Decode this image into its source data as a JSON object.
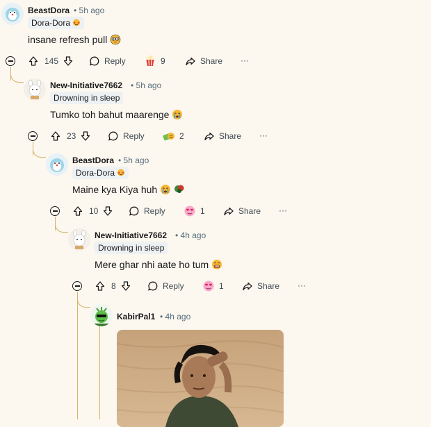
{
  "comments": [
    {
      "username": "BeastDora",
      "time": "5h ago",
      "flair": "Dora-Dora",
      "text": "insane refresh pull",
      "votes": "145",
      "reply_label": "Reply",
      "award_count": "9",
      "share_label": "Share",
      "more": "···"
    },
    {
      "username": "New-Initiative7662",
      "time": "5h ago",
      "flair": "Drowning in sleep",
      "text": "Tumko toh bahut maarenge",
      "votes": "23",
      "reply_label": "Reply",
      "award_count": "2",
      "share_label": "Share",
      "more": "···"
    },
    {
      "username": "BeastDora",
      "time": "5h ago",
      "flair": "Dora-Dora",
      "text": "Maine kya Kiya huh",
      "votes": "10",
      "reply_label": "Reply",
      "award_count": "1",
      "share_label": "Share",
      "more": "···"
    },
    {
      "username": "New-Initiative7662",
      "time": "4h ago",
      "flair": "Drowning in sleep",
      "text": "Mere ghar nhi aate ho tum",
      "votes": "8",
      "reply_label": "Reply",
      "award_count": "1",
      "share_label": "Share",
      "more": "···"
    },
    {
      "username": "KabirPal1",
      "time": "4h ago"
    }
  ],
  "separator": "•",
  "colors": {
    "background": "#fcf7ef",
    "thread_line": "#d2b46a",
    "meta": "#576f7d"
  }
}
